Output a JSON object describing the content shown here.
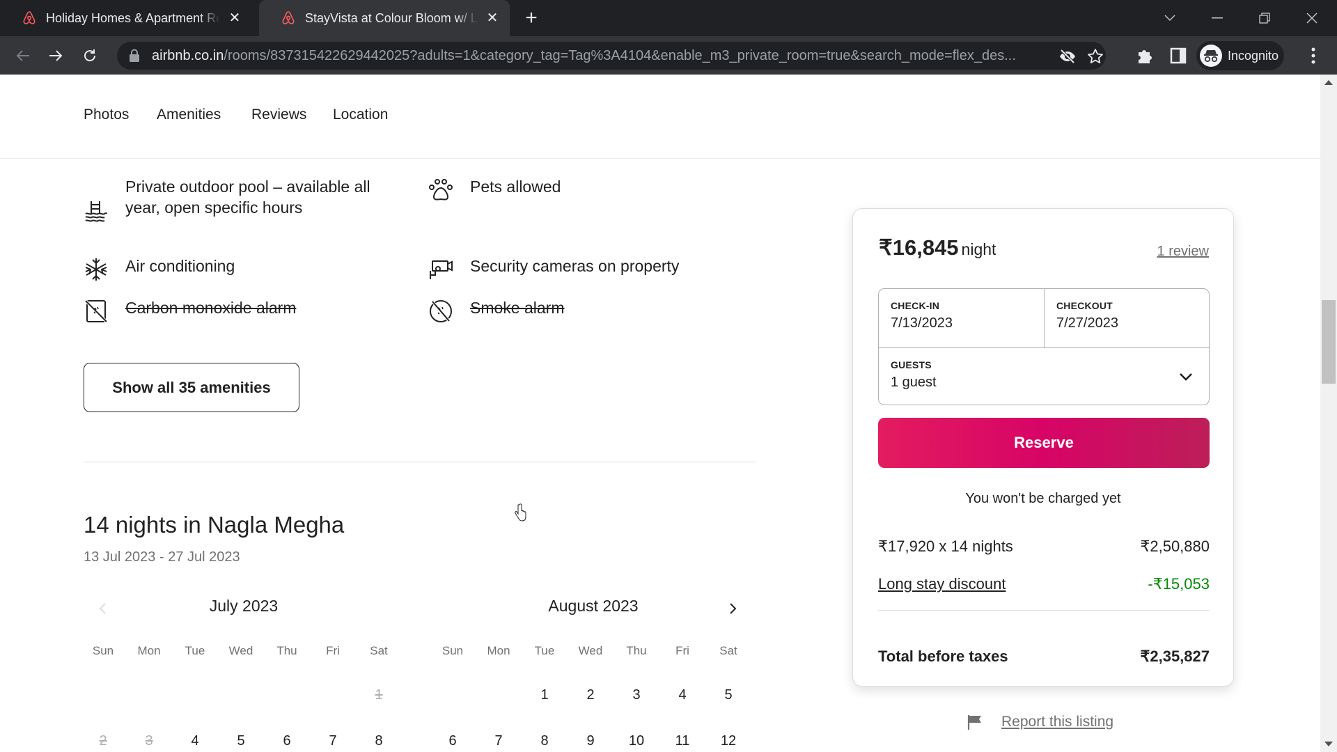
{
  "browser": {
    "tabs": [
      {
        "title": "Holiday Homes & Apartment Rentals - Airbnb",
        "active": false,
        "icon": "airbnb-logo-icon"
      },
      {
        "title": "StayVista at Colour Bloom w/ Lawn",
        "active": true,
        "icon": "airbnb-logo-icon"
      }
    ],
    "url_host": "airbnb.co.in",
    "url_path": "/rooms/837315422629442025?adults=1&category_tag=Tag%3A4104&enable_m3_private_room=true&search_mode=flex_des...",
    "profile_label": "Incognito",
    "accent_color": "#e31c5f"
  },
  "subnav": {
    "links": [
      "Photos",
      "Amenities",
      "Reviews",
      "Location"
    ]
  },
  "amenities": {
    "items": [
      {
        "label": "Private outdoor pool – available all year, open specific hours",
        "icon": "pool-icon",
        "available": true
      },
      {
        "label": "Pets allowed",
        "icon": "paw-icon",
        "available": true
      },
      {
        "label": "Air conditioning",
        "icon": "snowflake-icon",
        "available": true
      },
      {
        "label": "Security cameras on property",
        "icon": "security-camera-icon",
        "available": true
      },
      {
        "label": "Carbon monoxide alarm",
        "icon": "co-alarm-off-icon",
        "available": false
      },
      {
        "label": "Smoke alarm",
        "icon": "smoke-alarm-off-icon",
        "available": false
      }
    ],
    "show_all_label": "Show all 35 amenities"
  },
  "stay": {
    "title": "14 nights in Nagla Megha",
    "range": "13 Jul 2023 - 27 Jul 2023"
  },
  "calendar": {
    "weekdays": [
      "Sun",
      "Mon",
      "Tue",
      "Wed",
      "Thu",
      "Fri",
      "Sat"
    ],
    "months": [
      {
        "name": "July 2023",
        "first_weekday_index": 6,
        "days_visible": [
          "1",
          "2",
          "3",
          "4",
          "5",
          "6",
          "7",
          "8"
        ],
        "disabled": [
          "1",
          "2",
          "3"
        ]
      },
      {
        "name": "August 2023",
        "first_weekday_index": 2,
        "days_visible": [
          "1",
          "2",
          "3",
          "4",
          "5",
          "6",
          "7",
          "8",
          "9",
          "10",
          "11",
          "12"
        ],
        "disabled": []
      }
    ]
  },
  "booking": {
    "price": "₹16,845",
    "price_unit": "night",
    "reviews_link": "1 review",
    "checkin_label": "CHECK-IN",
    "checkin_value": "7/13/2023",
    "checkout_label": "CHECKOUT",
    "checkout_value": "7/27/2023",
    "guests_label": "GUESTS",
    "guests_value": "1 guest",
    "reserve_label": "Reserve",
    "no_charge_note": "You won't be charged yet",
    "lines": [
      {
        "label": "₹17,920 x 14 nights",
        "amount": "₹2,50,880"
      },
      {
        "label": "Long stay discount",
        "amount": "-₹15,053"
      }
    ],
    "total_label": "Total before taxes",
    "total_amount": "₹2,35,827",
    "discount_color": "#008a05"
  },
  "report_link": "Report this listing"
}
